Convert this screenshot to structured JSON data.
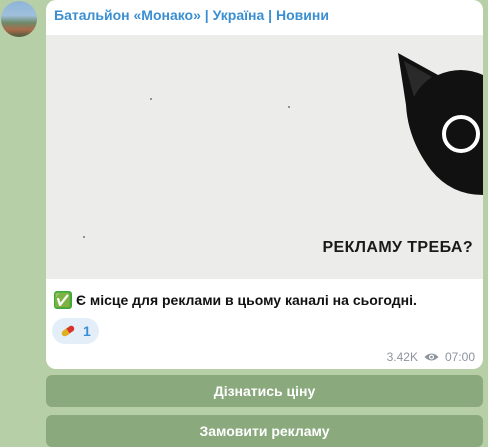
{
  "channel": {
    "name": "Батальйон «Монако» | Україна | Новини",
    "avatar_icon": "channel-avatar"
  },
  "post": {
    "image_caption": "РЕКЛАМУ ТРЕБА?",
    "check_icon": "✅",
    "text": "Є місце для реклами в цьому каналі на сьогодні.",
    "reaction": {
      "icon": "pill-icon",
      "count": "1"
    },
    "views": "3.42K",
    "views_icon": "eye-icon",
    "time": "07:00"
  },
  "buttons": {
    "price_label": "Дізнатись ціну",
    "order_label": "Замовити рекламу"
  },
  "colors": {
    "background": "#b7cfa6",
    "accent": "#3a8fd2",
    "button": "#8aa97d"
  }
}
